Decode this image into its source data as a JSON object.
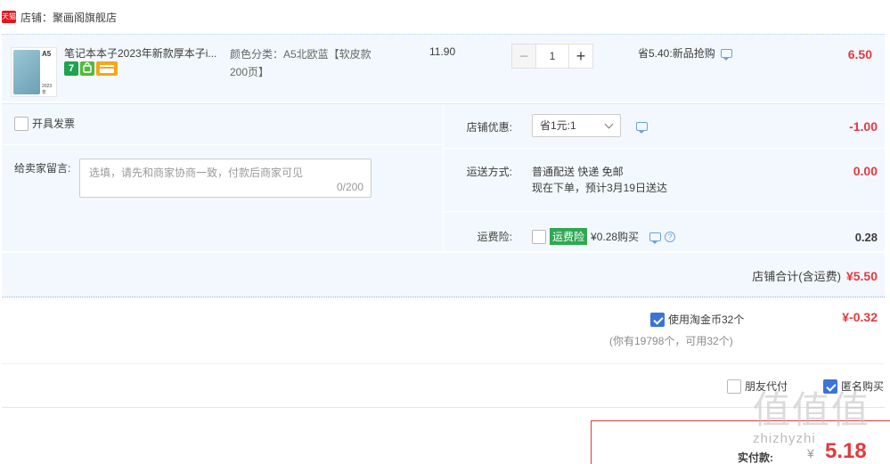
{
  "shop": {
    "badge": "天猫",
    "label": "店铺：聚画阁旗舰店"
  },
  "item": {
    "thumb_a5": "A5",
    "thumb_year": "2023年",
    "title": "笔记本本子2023年新款厚本子i...",
    "icons": [
      "seven-day-return-icon",
      "guarantee-icon",
      "card-icon"
    ],
    "icon_7_text": "7",
    "sku": "颜色分类：A5北欧蓝【软皮款200页】",
    "unit_price": "11.90",
    "quantity": "1",
    "promo": "省5.40:新品抢购",
    "total": "6.50"
  },
  "extras": {
    "invoice_label": "开具发票",
    "memo_label": "给卖家留言:",
    "memo_placeholder": "选填，请先和商家协商一致，付款后商家可见",
    "memo_count": "0/200",
    "discount_label": "店铺优惠:",
    "discount_selected": "省1元:1",
    "discount_value": "-1.00",
    "shipping_label": "运送方式:",
    "shipping_line1": "普通配送 快递 免邮",
    "shipping_line2": "现在下单，预计3月19日送达",
    "shipping_value": "0.00",
    "insurance_label": "运费险:",
    "insurance_tag": "运费险",
    "insurance_text": "¥0.28购买",
    "insurance_value": "0.28"
  },
  "shop_total": {
    "label": "店铺合计(含运费)",
    "value": "¥5.50"
  },
  "coins": {
    "label": "使用淘金币32个",
    "sub": "(你有19798个，可用32个)",
    "value": "¥-0.32",
    "checked": true
  },
  "options": {
    "friend_pay": "朋友代付",
    "anonymous": "匿名购买"
  },
  "payment": {
    "label": "实付款:",
    "currency": "¥",
    "value": "5.18"
  },
  "watermark": {
    "glyphs": "值值值",
    "url": "zhizhyzhi"
  },
  "colors": {
    "accent_red": "#e4393c",
    "panel_blue": "#f3f8fe",
    "check_blue": "#3b73d9",
    "insurance_green": "#2fa853"
  }
}
